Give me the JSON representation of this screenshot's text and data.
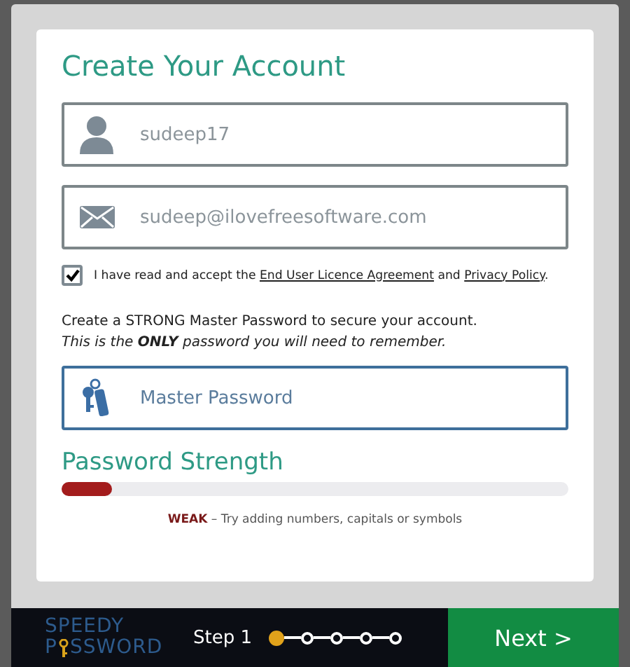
{
  "title": "Create Your Account",
  "fields": [
    {
      "kind": "user",
      "value": "sudeep17"
    },
    {
      "kind": "mail",
      "value": "sudeep@ilovefreesoftware.com"
    }
  ],
  "agreement": {
    "checked": true,
    "parts": [
      {
        "kind": "text",
        "text": "I have read and accept the"
      },
      {
        "kind": "link",
        "text": "End User Licence Agreement"
      },
      {
        "kind": "text",
        "text": "and"
      },
      {
        "kind": "link",
        "text": "Privacy Policy"
      },
      {
        "kind": "tail",
        "text": "."
      }
    ]
  },
  "instructions": [
    "Create a STRONG Master Password to secure your account.",
    "This is the **ONLY** password you will need to remember."
  ],
  "master_password": {
    "placeholder": "Master Password"
  },
  "strength": {
    "heading": "Password Strength",
    "level": 0.1,
    "message": "**WEAK** – Try adding numbers, capitals or symbols"
  },
  "footer": {
    "logo_top": "SPEEDY",
    "logo_before_key": "P",
    "logo_after_key": "SSWORD",
    "step_label": "Step 1",
    "steps": [
      {
        "selected": true
      },
      {
        "selected": false
      },
      {
        "selected": false
      },
      {
        "selected": false
      },
      {
        "selected": false
      }
    ],
    "next_button": "Next >"
  }
}
